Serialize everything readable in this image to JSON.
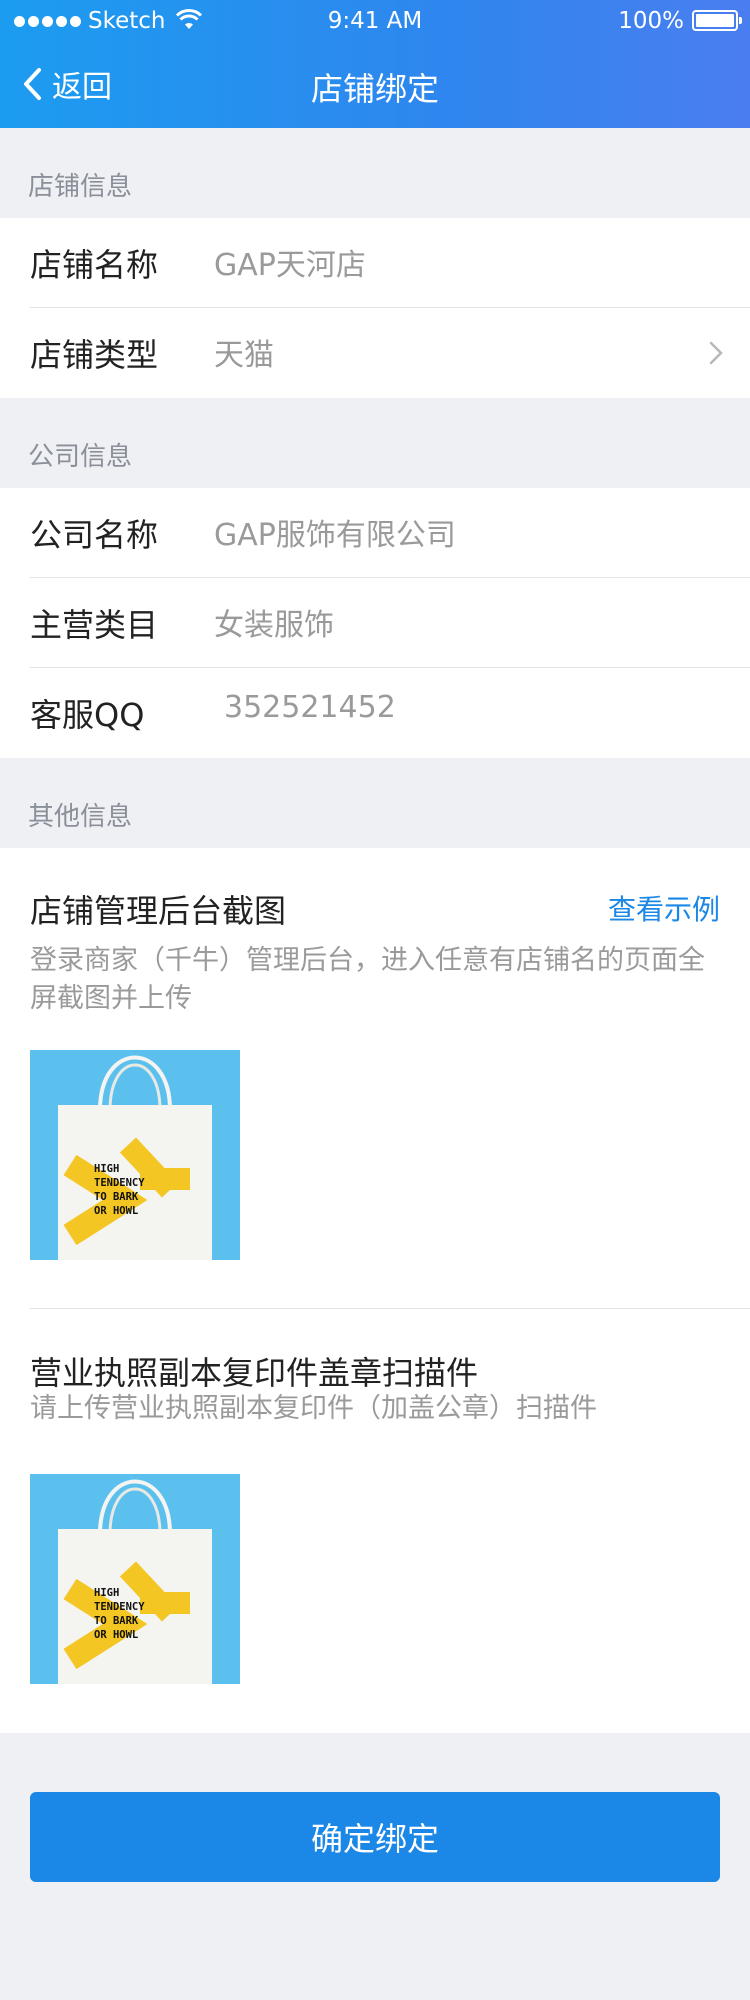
{
  "status_bar": {
    "carrier": "Sketch",
    "time": "9:41 AM",
    "battery": "100%"
  },
  "nav": {
    "back_label": "返回",
    "title": "店铺绑定"
  },
  "sections": {
    "store": {
      "title": "店铺信息",
      "rows": [
        {
          "label": "店铺名称",
          "value": "GAP天河店"
        },
        {
          "label": "店铺类型",
          "value": "天猫"
        }
      ]
    },
    "company": {
      "title": "公司信息",
      "rows": [
        {
          "label": "公司名称",
          "value": "GAP服饰有限公司"
        },
        {
          "label": "主营类目",
          "value": "女装服饰"
        },
        {
          "label": "客服QQ",
          "value": "352521452"
        }
      ]
    },
    "other": {
      "title": "其他信息",
      "uploads": [
        {
          "title": "店铺管理后台截图",
          "link": "查看示例",
          "desc": "登录商家（千牛）管理后台，进入任意有店铺名的页面全屏截图并上传",
          "image_text": "HIGH TENDENCY TO BARK OR HOWL"
        },
        {
          "title": "营业执照副本复印件盖章扫描件",
          "desc": "请上传营业执照副本复印件（加盖公章）扫描件",
          "image_text": "HIGH TENDENCY TO BARK OR HOWL"
        }
      ]
    }
  },
  "confirm_button": "确定绑定",
  "colors": {
    "accent": "#1b87e6",
    "header_start": "#1c9cf0",
    "header_end": "#4a7ef0",
    "thumb_bg": "#5bc0ee",
    "tote_mark": "#f3c623"
  }
}
